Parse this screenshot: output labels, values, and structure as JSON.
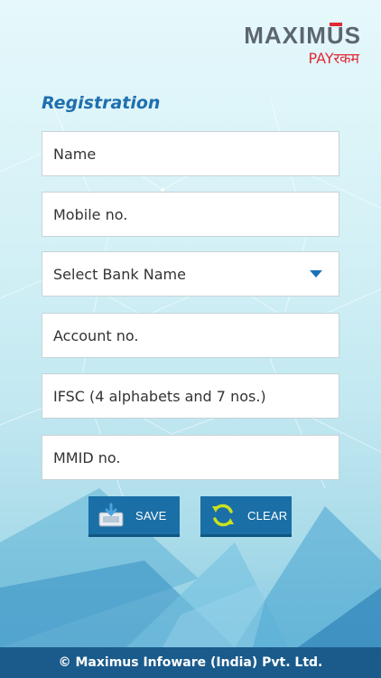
{
  "brand": {
    "name_prefix": "MAXIM",
    "name_u": "U",
    "name_suffix": "S",
    "sub": "PAYरकम"
  },
  "page": {
    "title": "Registration"
  },
  "form": {
    "name_placeholder": "Name",
    "mobile_placeholder": "Mobile no.",
    "bank_select_value": "Select Bank Name",
    "account_placeholder": "Account no.",
    "ifsc_placeholder": "IFSC (4 alphabets and 7 nos.)",
    "mmid_placeholder": "MMID no."
  },
  "actions": {
    "save_label": "SAVE",
    "clear_label": "CLEAR"
  },
  "footer": {
    "text": "© Maximus Infoware (India) Pvt. Ltd."
  },
  "colors": {
    "accent": "#1a6fa6",
    "brand_red": "#e02a36",
    "title_blue": "#1f6fae",
    "footer_bg": "#1a5b8c"
  },
  "icons": {
    "save": "save-disk-icon",
    "clear": "refresh-arrows-icon",
    "select": "caret-down-icon"
  }
}
